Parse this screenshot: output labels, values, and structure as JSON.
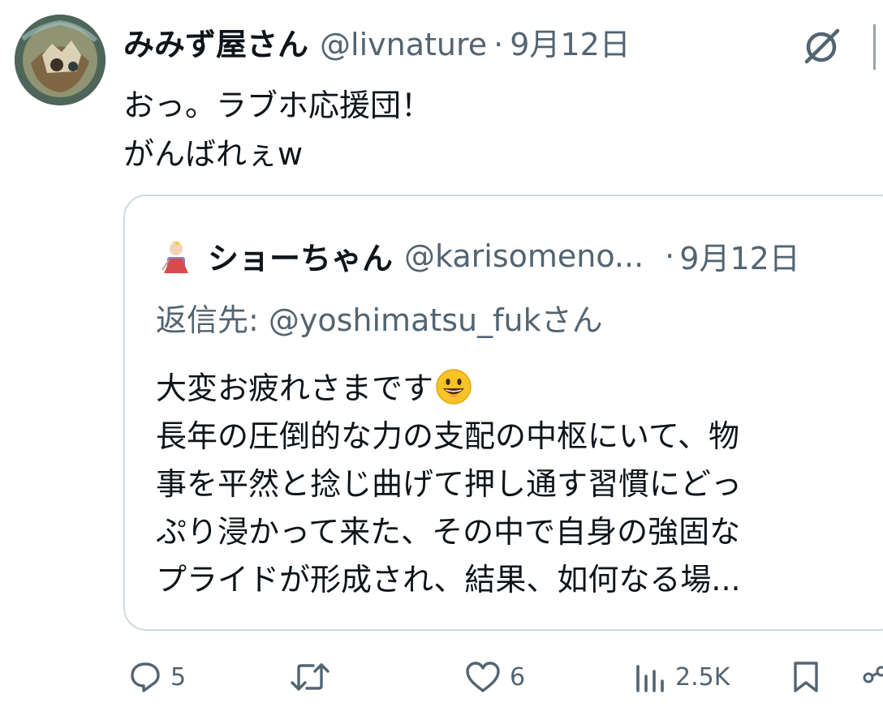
{
  "post": {
    "author_name": "みみず屋さん",
    "author_handle": "@livnature",
    "dot": "·",
    "date": "9月12日",
    "text_lines": [
      "おっ。ラブホ応援団！",
      "がんばれぇw"
    ]
  },
  "quote": {
    "author_name": "ショーちゃん",
    "author_handle": "@karisomeno...",
    "dot": "·",
    "date": "9月12日",
    "reply_to": "返信先: @yoshimatsu_fukさん",
    "body_lines": [
      "大変お疲れさまです",
      "長年の圧倒的な力の支配の中枢にいて、物",
      "事を平然と捻じ曲げて押し通す習慣にどっ",
      "ぷり浸かって来た、その中で自身の強固な",
      "プライドが形成され、結果、如何なる場..."
    ]
  },
  "actions": {
    "reply_count": "5",
    "like_count": "6",
    "views_count": "2.5K"
  },
  "icons": {
    "grok": "grok-icon",
    "reply": "reply-icon",
    "repost": "repost-icon",
    "like": "heart-icon",
    "views": "views-icon",
    "bookmark": "bookmark-icon",
    "share": "share-icon",
    "emoji": "grinning-face-icon"
  },
  "colors": {
    "text": "#0f1419",
    "muted": "#536471",
    "border": "#cfd9de"
  }
}
